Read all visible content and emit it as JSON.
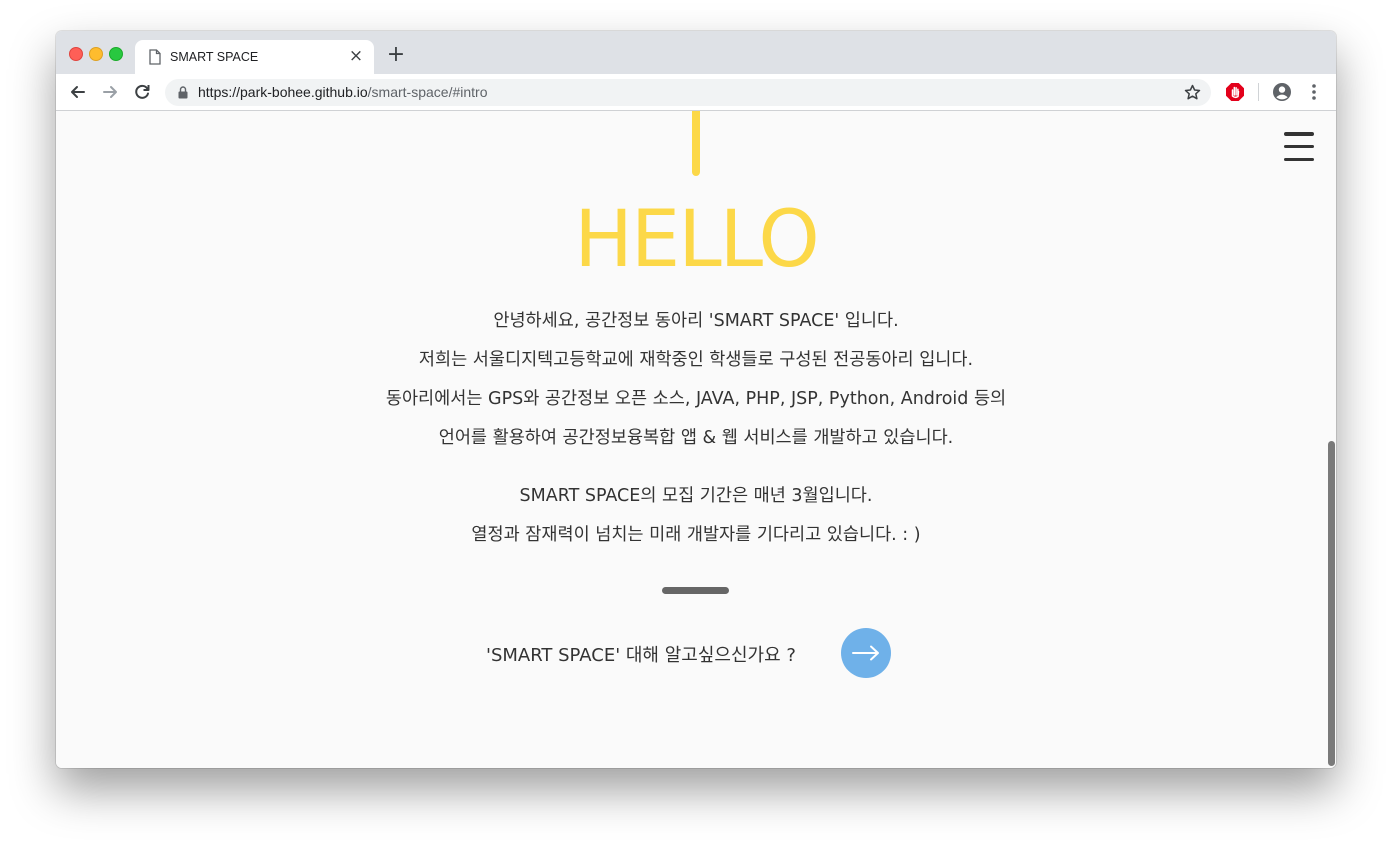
{
  "browser": {
    "tab_title": "SMART SPACE",
    "tab_close": "×",
    "new_tab": "+",
    "url_host": "https://park-bohee.github.io",
    "url_path": "/smart-space/#intro"
  },
  "page": {
    "heading": "HELLO",
    "intro_paragraph_1": [
      "안녕하세요, 공간정보 동아리 'SMART SPACE' 입니다.",
      "저희는 서울디지텍고등학교에 재학중인 학생들로 구성된 전공동아리 입니다.",
      "동아리에서는 GPS와 공간정보 오픈 소스, JAVA, PHP, JSP, Python, Android 등의",
      "언어를 활용하여 공간정보융복합 앱 & 웹 서비스를 개발하고 있습니다."
    ],
    "intro_paragraph_2": [
      "SMART SPACE의 모집 기간은 매년 3월입니다.",
      "열정과 잠재력이 넘치는 미래 개발자를 기다리고 있습니다. : )"
    ],
    "cta_question": "'SMART SPACE' 대해 알고싶으신가요 ?"
  },
  "colors": {
    "accent_yellow": "#fcd848",
    "cta_blue": "#6fb1e9",
    "text": "#333333",
    "background": "#fafafa"
  },
  "icons": {
    "tab": "document-icon",
    "back": "back-arrow-icon",
    "forward": "forward-arrow-icon",
    "reload": "reload-icon",
    "secure": "lock-icon",
    "bookmark": "star-icon",
    "extension": "adblock-hand-icon",
    "profile": "account-icon",
    "browser_menu": "more-vert-icon",
    "site_menu": "hamburger-menu-icon",
    "cta": "arrow-right-icon"
  }
}
